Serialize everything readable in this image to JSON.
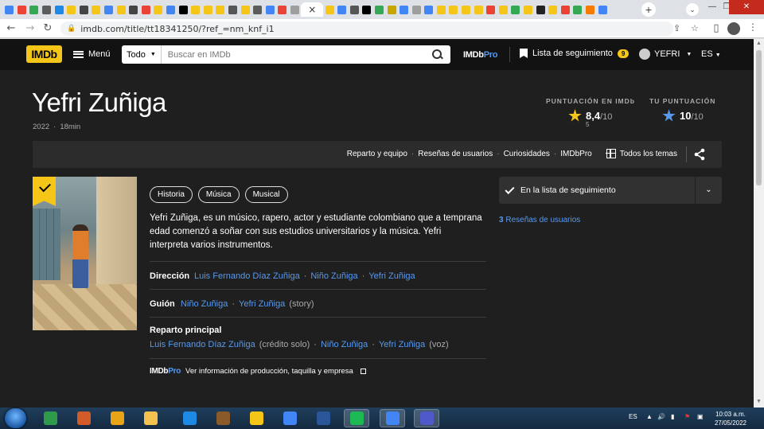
{
  "browser": {
    "active_tab_icon": "×",
    "new_tab": "+",
    "url": "imdb.com/title/tt18341250/?ref_=nm_knf_i1",
    "favicon_colors": [
      "#4285f4",
      "#ea4335",
      "#34a853",
      "#5c5c5c",
      "#1e88e5",
      "#f5c518",
      "#444",
      "#f5c518",
      "#4285f4",
      "#f5c518",
      "#444",
      "#ea4335",
      "#f5c518",
      "#4285f4",
      "#000",
      "#f5c518",
      "#f5c518",
      "#f5c518",
      "#555",
      "#f5c518",
      "#5c5c5c",
      "#4285f4",
      "#ea4335",
      "#9e9e9e"
    ],
    "favicon_colors_right": [
      "#f5c518",
      "#4285f4",
      "#555",
      "#000",
      "#34a853",
      "#c8a600",
      "#4285f4",
      "#9e9e9e",
      "#4285f4",
      "#f5c518",
      "#f5c518",
      "#f5c518",
      "#f5c518",
      "#ea4335",
      "#f5c518",
      "#34a853",
      "#f5c518",
      "#222",
      "#f5c518",
      "#ea4335",
      "#34a853",
      "#f57c00",
      "#4285f4"
    ]
  },
  "nav": {
    "logo": "IMDb",
    "menu_label": "Menú",
    "search_category": "Todo",
    "search_placeholder": "Buscar en IMDb",
    "pro_prefix": "IMDb",
    "pro_suffix": "Pro",
    "watchlist_label": "Lista de seguimiento",
    "watchlist_count": "9",
    "user_name": "YEFRI",
    "language": "ES"
  },
  "title": {
    "name": "Yefri Zuñiga",
    "year": "2022",
    "dot": "·",
    "runtime": "18min"
  },
  "ratings": {
    "imdb_label": "PUNTUACIÓN EN IMDb",
    "imdb_value": "8,4",
    "imdb_scale": "/10",
    "imdb_count": "5",
    "user_label": "TU PUNTUACIÓN",
    "user_value": "10",
    "user_scale": "/10"
  },
  "subnav": {
    "links": [
      "Reparto y equipo",
      "Reseñas de usuarios",
      "Curiosidades",
      "IMDbPro"
    ],
    "all_topics": "Todos los temas",
    "dot": "·"
  },
  "genres": [
    "Historia",
    "Música",
    "Musical"
  ],
  "plot": "Yefri Zuñiga, es un músico, rapero, actor y estudiante colombiano que a temprana edad comenzó a soñar con sus estudios universitarios y la música. Yefri interpreta varios instrumentos.",
  "credits": {
    "director_label": "Dirección",
    "directors": [
      "Luis Fernando Díaz Zuñiga",
      "Niño Zuñiga",
      "Yefri Zuñiga"
    ],
    "writer_label": "Guión",
    "writers": [
      "Niño Zuñiga",
      "Yefri Zuñiga"
    ],
    "writer_note": "(story)",
    "cast_label": "Reparto principal",
    "cast": [
      "Luis Fernando Díaz Zuñiga",
      "Niño Zuñiga",
      "Yefri Zuñiga"
    ],
    "cast_note_1": "(crédito solo)",
    "cast_note_3": "(voz)",
    "sep": "·"
  },
  "pro_line": {
    "logo_prefix": "IMDb",
    "logo_suffix": "Pro",
    "text": "Ver información de producción, taquilla y empresa"
  },
  "sidebar": {
    "watchlist_button": "En la lista de seguimiento",
    "reviews_count": "3",
    "reviews_label": "Reseñas de usuarios"
  },
  "taskbar": {
    "lang": "ES",
    "time": "10:03 a.m.",
    "date": "27/05/2022",
    "app_colors": [
      "#2e9b4a",
      "#d35b2a",
      "#e8a317",
      "#f2c14e",
      "#1e88e5",
      "#8a5a2b",
      "#f5c518",
      "#4285f4",
      "#2b579a",
      "#1db954",
      "#4285f4",
      "#5059c9"
    ]
  }
}
